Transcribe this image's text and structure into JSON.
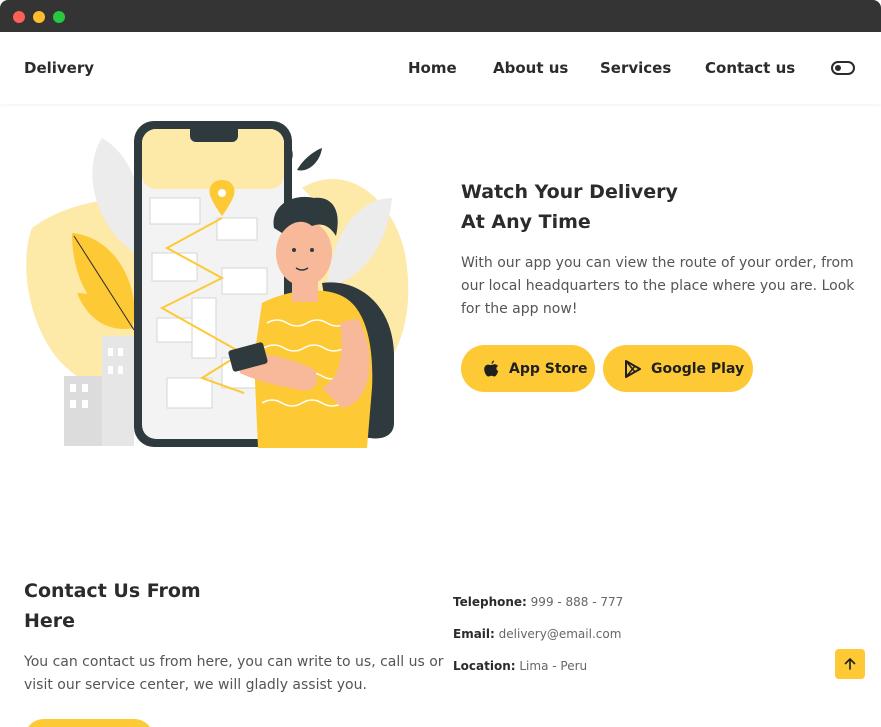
{
  "header": {
    "logo": "Delivery",
    "nav": [
      "Home",
      "About us",
      "Services",
      "Contact us"
    ],
    "theme_toggle_icon": "toggle-icon"
  },
  "app_section": {
    "title_line1": "Watch Your Delivery",
    "title_line2": "At Any Time",
    "description": "With our app you can view the route of your order, from our local headquarters to the place where you are. Look for the app now!",
    "buttons": [
      {
        "label": "App Store",
        "icon": "apple-icon"
      },
      {
        "label": "Google Play",
        "icon": "google-play-icon"
      }
    ]
  },
  "contact_section": {
    "title_line1": "Contact Us From",
    "title_line2": "Here",
    "description": "You can contact us from here, you can write to us, call us or visit our service center, we will gladly assist you.",
    "telephone_label": "Telephone:",
    "telephone": "999 - 888 - 777",
    "email_label": "Email:",
    "email": "delivery@email.com",
    "location_label": "Location:",
    "location": "Lima - Peru"
  },
  "scroll_top_icon": "arrow-up-icon",
  "colors": {
    "accent": "#fdc935",
    "text": "#2b2b2b",
    "titlebar": "#343434"
  }
}
